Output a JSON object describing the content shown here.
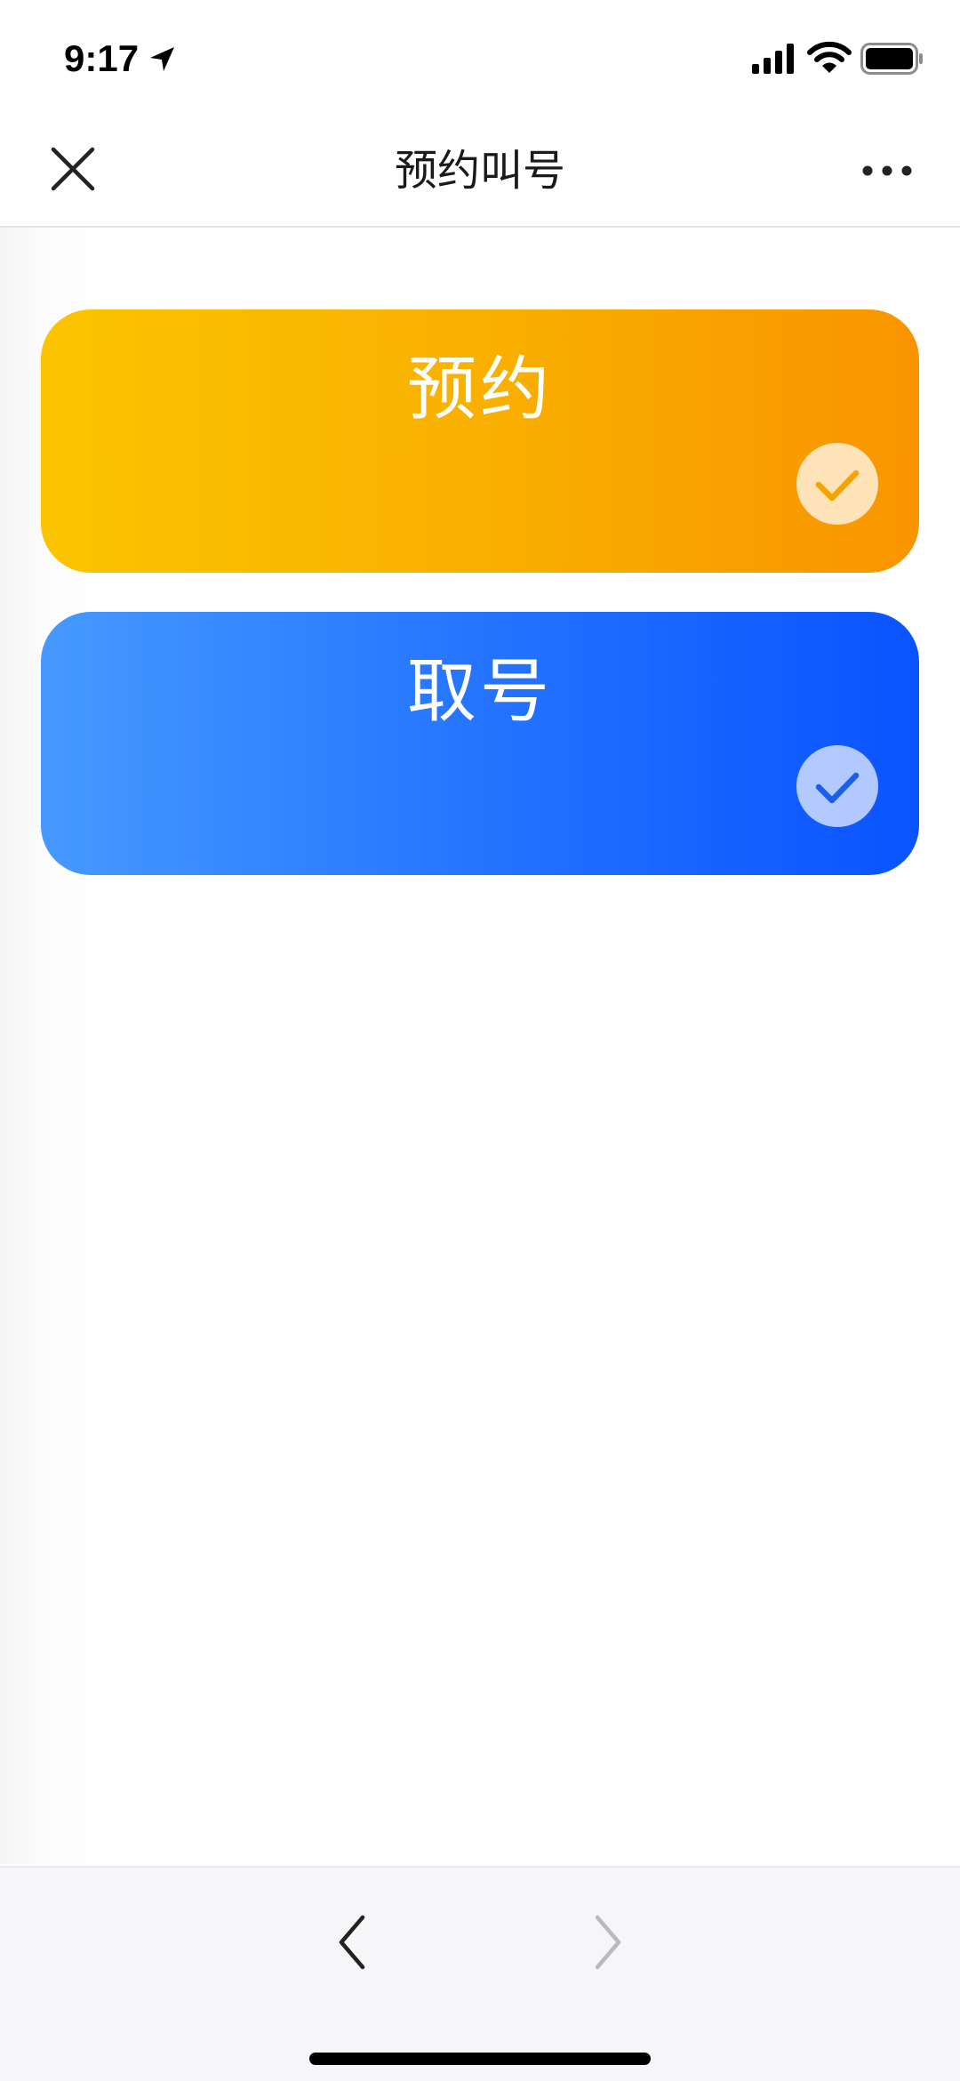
{
  "status_bar": {
    "time": "9:17",
    "icons": [
      "location-arrow-icon",
      "cellular-signal-icon",
      "wifi-icon",
      "battery-icon"
    ]
  },
  "nav": {
    "title": "预约叫号",
    "close_icon": "close-icon",
    "more_icon": "more-horizontal-icon"
  },
  "options": [
    {
      "label": "预约",
      "icon": "check-circle-icon",
      "colors": {
        "start": "#fbc400",
        "end": "#f99400",
        "check": "#f5a300"
      }
    },
    {
      "label": "取号",
      "icon": "check-circle-icon",
      "colors": {
        "start": "#4799ff",
        "end": "#0a53ff",
        "check": "#1b5fe8"
      }
    }
  ],
  "toolbar": {
    "back_icon": "chevron-left-icon",
    "forward_icon": "chevron-right-icon",
    "forward_enabled": false
  }
}
